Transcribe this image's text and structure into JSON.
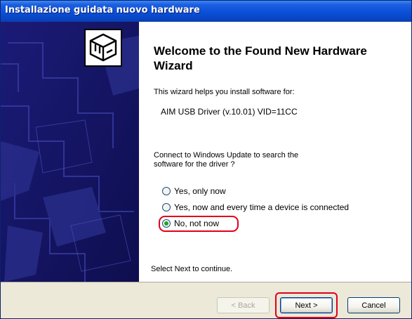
{
  "window": {
    "title": "Installazione guidata nuovo hardware"
  },
  "welcome": {
    "heading": "Welcome to the Found New Hardware Wizard",
    "intro": "This wizard helps you install software for:",
    "device": "AIM USB Driver (v.10.01) VID=11CC",
    "question_line1": "Connect to  Windows Update to search the",
    "question_line2": "software for the driver ?",
    "options": [
      {
        "label": "Yes, only now",
        "selected": false
      },
      {
        "label": "Yes, now and every time a device is connected",
        "selected": false
      },
      {
        "label": "No, not now",
        "selected": true
      }
    ],
    "footer_text": "Select Next to continue."
  },
  "buttons": {
    "back_label": "< Back",
    "next_label": "Next >",
    "cancel_label": "Cancel"
  },
  "colors": {
    "titlebar": "#0a4fd8",
    "sidebar": "#13135e",
    "highlight": "#e0001a",
    "radio_dot": "#21a121"
  }
}
